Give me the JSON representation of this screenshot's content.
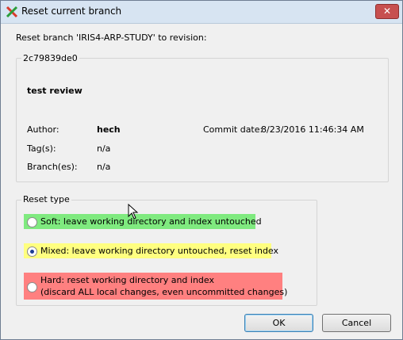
{
  "window": {
    "title": "Reset current branch",
    "close_label": "✕"
  },
  "intro": "Reset branch 'IRIS4-ARP-STUDY' to revision:",
  "revision": {
    "hash": "2c79839de0",
    "message": "test review",
    "author_label": "Author:",
    "author": "hech",
    "commit_date_label": "Commit date:",
    "commit_date": "8/23/2016 11:46:34 AM",
    "tags_label": "Tag(s):",
    "tags": "n/a",
    "branches_label": "Branch(es):",
    "branches": "n/a"
  },
  "reset_type": {
    "legend": "Reset type",
    "selected": "mixed",
    "options": [
      {
        "id": "soft",
        "label": "Soft: leave working directory and index untouched",
        "color": "#7fea7f"
      },
      {
        "id": "mixed",
        "label": "Mixed: leave working directory untouched, reset index",
        "color": "#ffff80"
      },
      {
        "id": "hard",
        "label": "Hard: reset working directory and index",
        "label2": "(discard ALL local changes, even uncommitted changes)",
        "color": "#ff8080"
      }
    ]
  },
  "buttons": {
    "ok": "OK",
    "cancel": "Cancel"
  }
}
